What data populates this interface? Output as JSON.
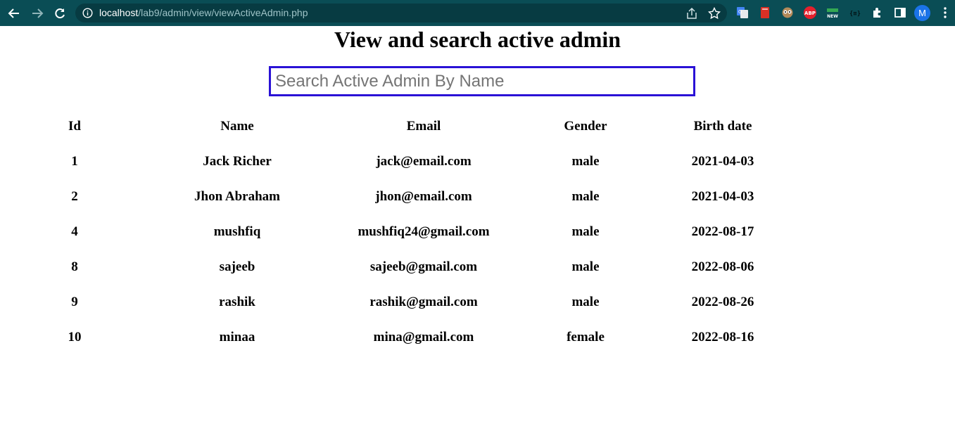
{
  "browser": {
    "url_host": "localhost",
    "url_path": "/lab9/admin/view/viewActiveAdmin.php",
    "profile_initial": "M",
    "abp_label": "ABP",
    "new_label": "NEW",
    "ext_code_label": "{≡}",
    "colors": {
      "toolbar": "#0a4d55",
      "omnibox": "#073b42",
      "profile": "#1a73e8",
      "abp": "#e5202d"
    }
  },
  "page": {
    "title": "View and search active admin",
    "search_placeholder": "Search Active Admin By Name",
    "search_value": ""
  },
  "table": {
    "headers": [
      "Id",
      "Name",
      "Email",
      "Gender",
      "Birth date"
    ],
    "rows": [
      [
        "1",
        "Jack Richer",
        "jack@email.com",
        "male",
        "2021-04-03"
      ],
      [
        "2",
        "Jhon Abraham",
        "jhon@email.com",
        "male",
        "2021-04-03"
      ],
      [
        "4",
        "mushfiq",
        "mushfiq24@gmail.com",
        "male",
        "2022-08-17"
      ],
      [
        "8",
        "sajeeb",
        "sajeeb@gmail.com",
        "male",
        "2022-08-06"
      ],
      [
        "9",
        "rashik",
        "rashik@gmail.com",
        "male",
        "2022-08-26"
      ],
      [
        "10",
        "minaa",
        "mina@gmail.com",
        "female",
        "2022-08-16"
      ]
    ]
  }
}
